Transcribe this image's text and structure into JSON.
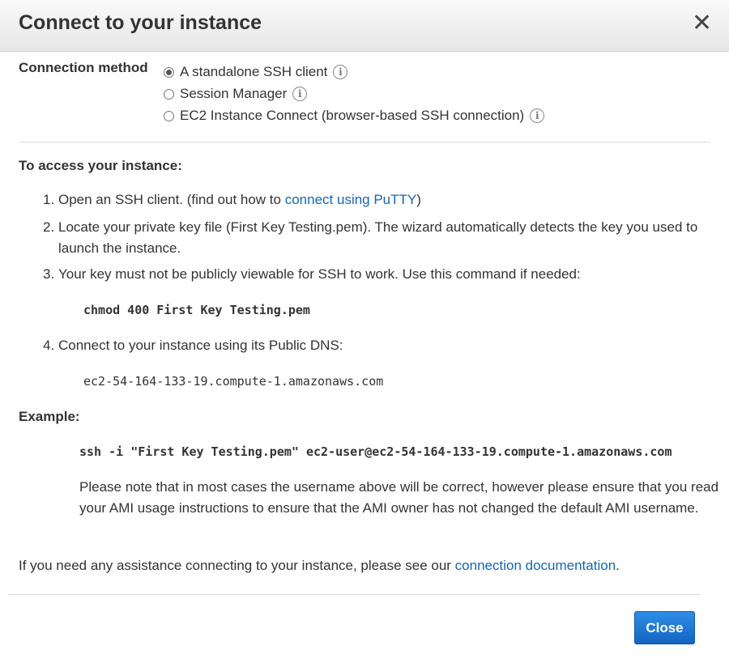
{
  "dialog": {
    "title": "Connect to your instance",
    "close_icon": "close-icon"
  },
  "connection_method": {
    "label": "Connection method",
    "options": [
      {
        "label": "A standalone SSH client",
        "selected": true
      },
      {
        "label": "Session Manager",
        "selected": false
      },
      {
        "label": "EC2 Instance Connect (browser-based SSH connection)",
        "selected": false
      }
    ]
  },
  "access": {
    "heading": "To access your instance:",
    "steps": [
      {
        "num": "1.",
        "text": "Open an SSH client. (find out how to ",
        "link": "connect using PuTTY",
        "after": ")"
      },
      {
        "num": "2.",
        "text": "Locate your private key file (First Key Testing.pem). The wizard automatically detects the key you used to launch the instance."
      },
      {
        "num": "3.",
        "text": "Your key must not be publicly viewable for SSH to work. Use this command if needed:"
      },
      {
        "num": "4.",
        "text": "Connect to your instance using its Public DNS:"
      }
    ],
    "chmod_command": "chmod 400 First Key Testing.pem",
    "public_dns": "ec2-54-164-133-19.compute-1.amazonaws.com"
  },
  "example": {
    "heading": "Example:",
    "command": "ssh -i \"First Key Testing.pem\" ec2-user@ec2-54-164-133-19.compute-1.amazonaws.com",
    "note": "Please note that in most cases the username above will be correct, however please ensure that you read your AMI usage instructions to ensure that the AMI owner has not changed the default AMI username."
  },
  "footer": {
    "help_text": "If you need any assistance connecting to your instance, please see our ",
    "help_link": "connection documentation",
    "help_after": ".",
    "close_label": "Close"
  },
  "colors": {
    "link": "#1466b8",
    "primary_button": "#1f7ad6",
    "header_bg": "#eeeeee"
  }
}
